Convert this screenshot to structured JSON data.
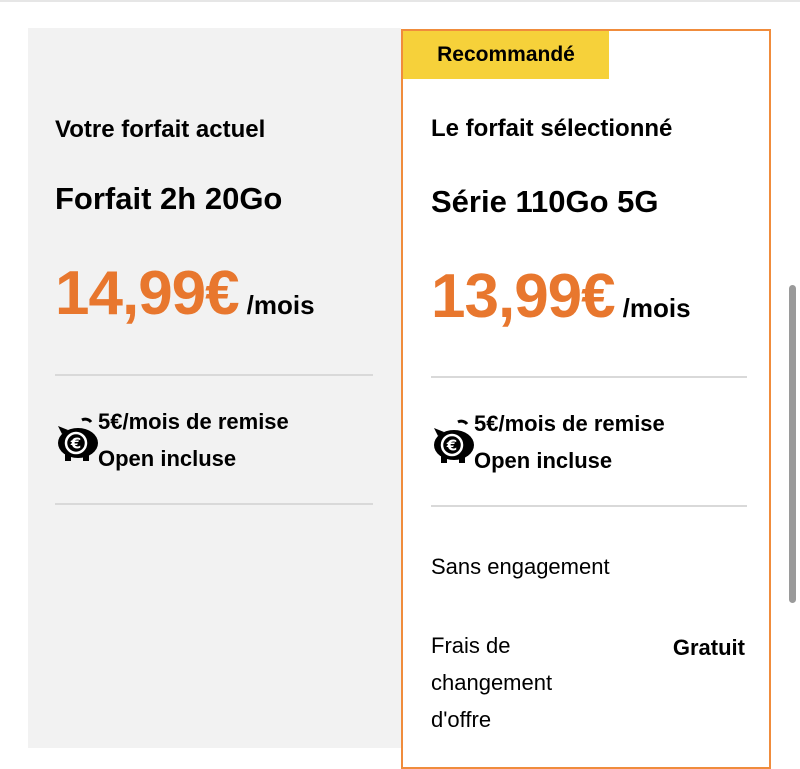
{
  "current": {
    "heading": "Votre forfait actuel",
    "plan": "Forfait 2h 20Go",
    "price": "14,99€",
    "unit": "/mois",
    "promo_line1": "5€/mois de remise",
    "promo_line2": "Open incluse"
  },
  "selected": {
    "badge": "Recommandé",
    "heading": "Le forfait sélectionné",
    "plan": "Série 110Go 5G",
    "price": "13,99€",
    "unit": "/mois",
    "promo_line1": "5€/mois de remise",
    "promo_line2": "Open incluse",
    "commitment": "Sans engagement",
    "fee_label_line1": "Frais de",
    "fee_label_line2": "changement",
    "fee_label_line3": "d'offre",
    "fee_value": "Gratuit"
  },
  "colors": {
    "accent_orange": "#e8772e",
    "badge_yellow": "#f6d13a",
    "border_orange": "#f08c3c"
  },
  "icons": {
    "promo": "piggy-bank-euro-icon"
  }
}
